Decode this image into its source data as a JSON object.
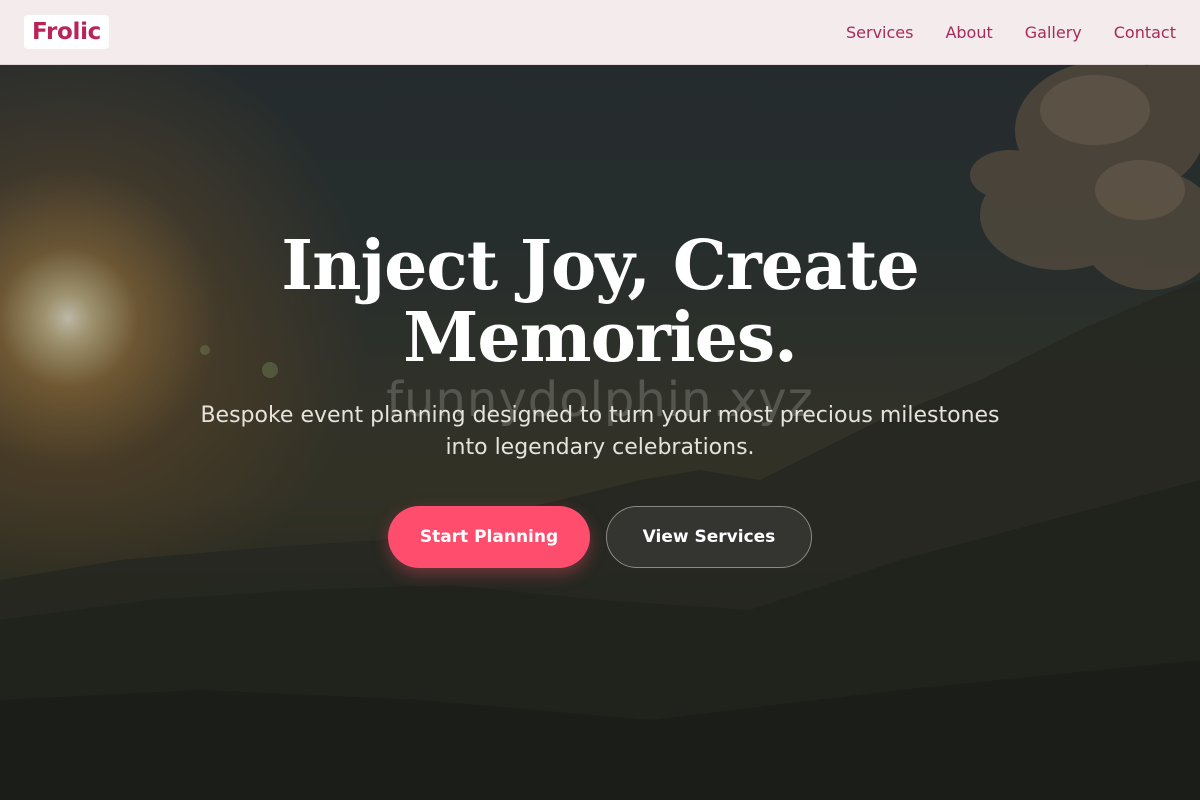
{
  "navbar": {
    "brand": "Frolic",
    "links": [
      "Services",
      "About",
      "Gallery",
      "Contact"
    ]
  },
  "hero": {
    "headline": "Inject Joy, Create Memories.",
    "watermark": "funnydolphin.xyz",
    "subtitle": "Bespoke event planning designed to turn your most precious milestones into legendary celebrations.",
    "primary_button": "Start Planning",
    "secondary_button": "View Services"
  },
  "colors": {
    "brand": "#b8245a",
    "nav_link": "#a82a5c",
    "primary_button": "#ff4d6d",
    "navbar_bg": "#f4ebed"
  },
  "icons": [
    "sun-glow",
    "mountain-silhouette",
    "cloud"
  ]
}
